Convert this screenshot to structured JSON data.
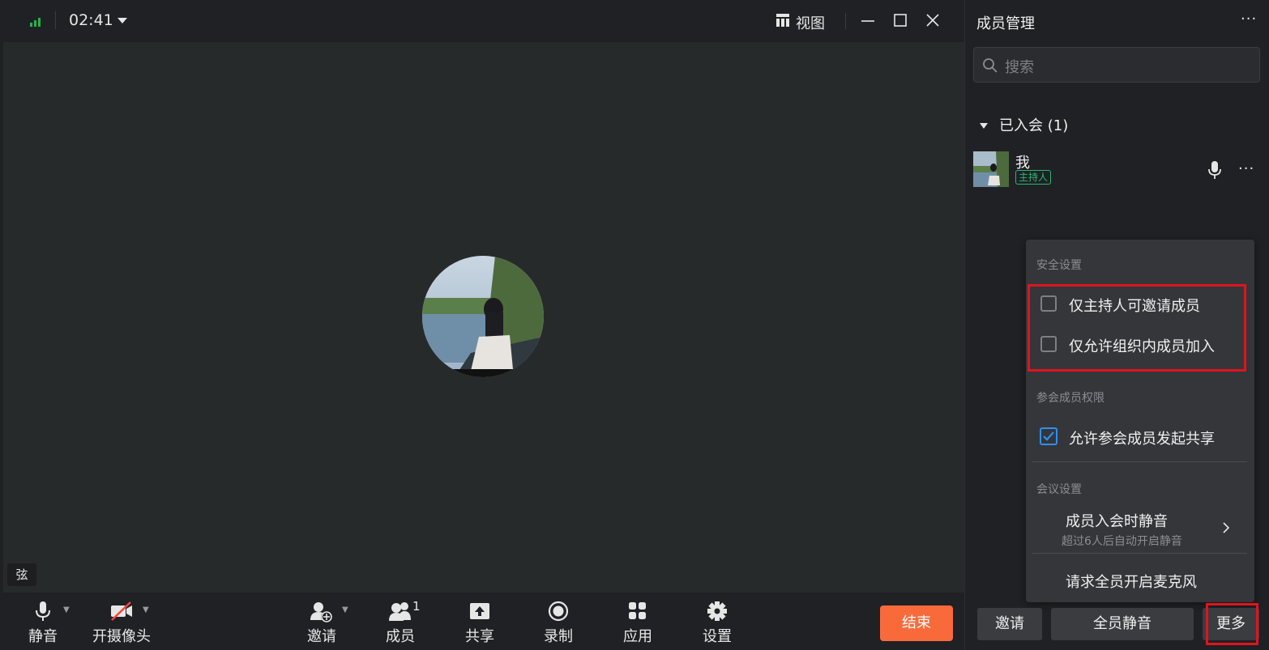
{
  "topbar": {
    "time": "02:41",
    "view_label": "视图"
  },
  "stage": {
    "name_tag": "弦"
  },
  "toolbar": {
    "mute": "静音",
    "camera": "开摄像头",
    "invite": "邀请",
    "members": "成员",
    "members_count": "1",
    "share": "共享",
    "record": "录制",
    "apps": "应用",
    "settings": "设置",
    "end": "结束"
  },
  "panel": {
    "title": "成员管理",
    "search_placeholder": "搜索",
    "joined_label": "已入会 (1)",
    "member": {
      "name": "我",
      "role": "主持人"
    },
    "buttons": {
      "invite": "邀请",
      "mute_all": "全员静音",
      "more": "更多"
    }
  },
  "menu": {
    "security_title": "安全设置",
    "opt_host_invite": "仅主持人可邀请成员",
    "opt_org_only": "仅允许组织内成员加入",
    "perm_title": "参会成员权限",
    "opt_allow_share": "允许参会成员发起共享",
    "meeting_title": "会议设置",
    "mute_on_join": "成员入会时静音",
    "mute_on_join_sub": "超过6人后自动开启静音",
    "ask_unmute": "请求全员开启麦克风"
  },
  "colors": {
    "accent_blue": "#2f8ff2",
    "end_orange": "#f96a3b",
    "highlight_red": "#e0141e",
    "host_green": "#2bb673"
  }
}
